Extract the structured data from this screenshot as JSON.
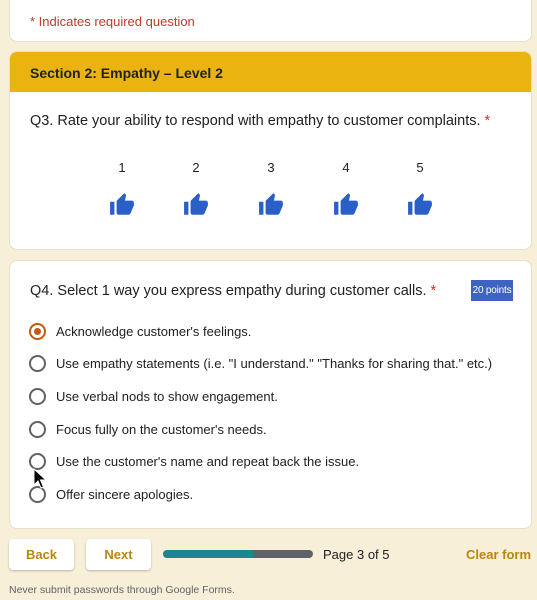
{
  "required_note": "* Indicates required question",
  "section": {
    "title": "Section 2: Empathy – Level 2",
    "accent_color": "#ebb30f"
  },
  "q3": {
    "text": "Q3. Rate your ability to respond with empathy to customer complaints.",
    "required_marker": "*",
    "scale": [
      "1",
      "2",
      "3",
      "4",
      "5"
    ],
    "icon": "thumbs-up-icon",
    "icon_color": "#2b5fc8"
  },
  "q4": {
    "text": "Q4. Select 1 way you express empathy during customer calls.",
    "required_marker": "*",
    "points": "20 points",
    "options": [
      "Acknowledge customer's feelings.",
      "Use empathy statements (i.e. \"I understand.\" \"Thanks for sharing that.\" etc.)",
      "Use verbal nods to show engagement.",
      "Focus fully on the customer's needs.",
      "Use the customer's name and repeat back the issue.",
      "Offer sincere apologies."
    ],
    "selected_index": 0,
    "selected_color": "#c25a11"
  },
  "nav": {
    "back_label": "Back",
    "next_label": "Next",
    "progress_fraction": 0.6,
    "page_indicator": "Page 3 of 5",
    "clear_label": "Clear form"
  },
  "footer": "Never submit passwords through Google Forms."
}
